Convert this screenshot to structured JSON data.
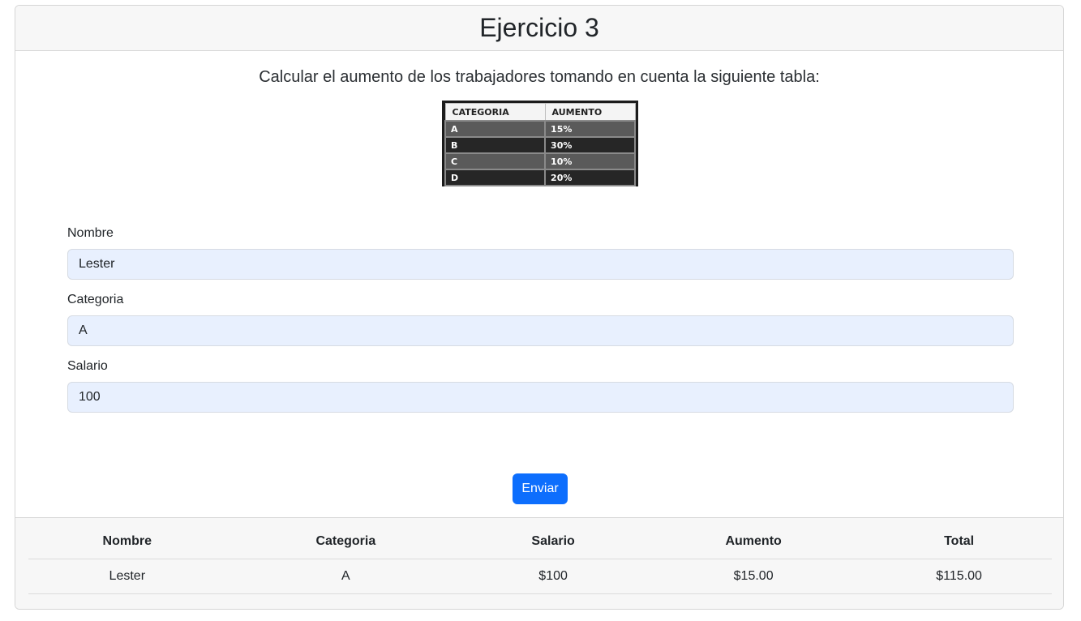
{
  "card": {
    "title": "Ejercicio 3",
    "intro": "Calcular el aumento de los trabajadores tomando en cuenta la siguiente tabla:"
  },
  "category_table": {
    "headers": [
      "CATEGORIA",
      "AUMENTO"
    ],
    "rows": [
      {
        "category": "A",
        "increase": "15%"
      },
      {
        "category": "B",
        "increase": "30%"
      },
      {
        "category": "C",
        "increase": "10%"
      },
      {
        "category": "D",
        "increase": "20%"
      }
    ]
  },
  "form": {
    "nombre_label": "Nombre",
    "nombre_value": "Lester",
    "categoria_label": "Categoria",
    "categoria_value": "A",
    "salario_label": "Salario",
    "salario_value": "100",
    "submit_label": "Enviar"
  },
  "results": {
    "headers": [
      "Nombre",
      "Categoria",
      "Salario",
      "Aumento",
      "Total"
    ],
    "rows": [
      [
        "Lester",
        "A",
        "$100",
        "$15.00",
        "$115.00"
      ]
    ]
  },
  "colors": {
    "primary_button": "#0d6efd",
    "input_autofill_bg": "#e8f0fe"
  }
}
